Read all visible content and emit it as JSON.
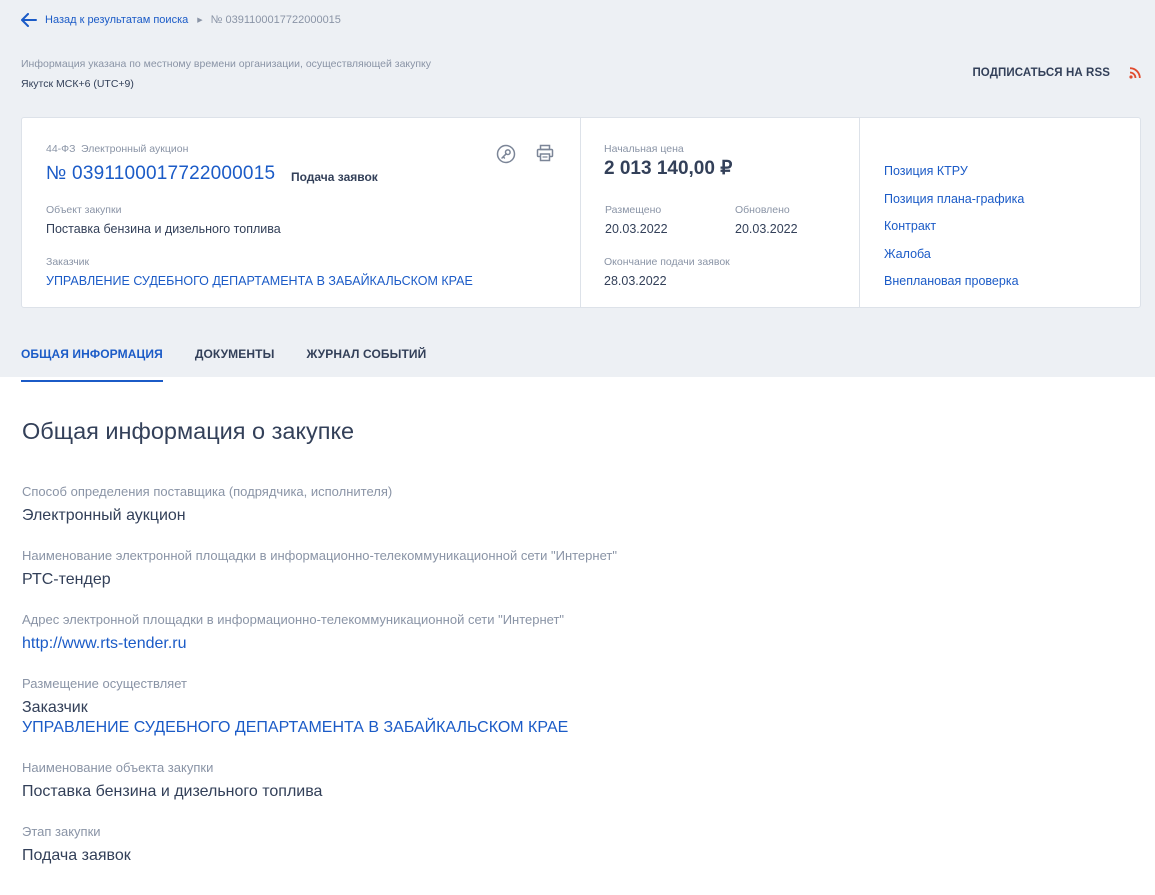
{
  "breadcrumb": {
    "back_label": "Назад к результатам поиска",
    "current": "№ 0391100017722000015"
  },
  "timezone": {
    "note": "Информация указана по местному времени организации, осуществляющей закупку",
    "value": "Якутск МСК+6 (UTC+9)"
  },
  "rss": {
    "label": "ПОДПИСАТЬСЯ НА RSS"
  },
  "card": {
    "law": "44-ФЗ",
    "procedure_type": "Электронный аукцион",
    "reg_number": "№ 0391100017722000015",
    "stage": "Подача заявок",
    "object_label": "Объект закупки",
    "object_value": "Поставка бензина и дизельного топлива",
    "customer_label": "Заказчик",
    "customer_value": "УПРАВЛЕНИЕ СУДЕБНОГО ДЕПАРТАМЕНТА В ЗАБАЙКАЛЬСКОМ КРАЕ",
    "price_label": "Начальная цена",
    "price_value": "2 013 140,00 ₽",
    "published_label": "Размещено",
    "published_value": "20.03.2022",
    "updated_label": "Обновлено",
    "updated_value": "20.03.2022",
    "deadline_label": "Окончание подачи заявок",
    "deadline_value": "28.03.2022",
    "links": [
      "Позиция КТРУ",
      "Позиция плана-графика",
      "Контракт",
      "Жалоба",
      "Внеплановая проверка"
    ]
  },
  "tabs": [
    "ОБЩАЯ ИНФОРМАЦИЯ",
    "ДОКУМЕНТЫ",
    "ЖУРНАЛ СОБЫТИЙ"
  ],
  "content": {
    "title": "Общая информация о закупке",
    "fields": [
      {
        "label": "Способ определения поставщика (подрядчика, исполнителя)",
        "value": "Электронный аукцион"
      },
      {
        "label": "Наименование электронной площадки в информационно-телекоммуникационной сети \"Интернет\"",
        "value": "РТС-тендер"
      },
      {
        "label": "Адрес электронной площадки в информационно-телекоммуникационной сети \"Интернет\"",
        "value": "http://www.rts-tender.ru"
      },
      {
        "label": "Размещение осуществляет",
        "value": "Заказчик",
        "value2": "УПРАВЛЕНИЕ СУДЕБНОГО ДЕПАРТАМЕНТА В ЗАБАЙКАЛЬСКОМ КРАЕ"
      },
      {
        "label": "Наименование объекта закупки",
        "value": "Поставка бензина и дизельного топлива"
      },
      {
        "label": "Этап закупки",
        "value": "Подача заявок"
      }
    ]
  },
  "icons": {
    "back": "arrow-left-icon",
    "separator": "triangle-right-icon",
    "rss": "rss-icon",
    "key": "key-icon",
    "print": "printer-icon"
  },
  "colors": {
    "link": "#1b5bc7",
    "rss": "#e04b2e",
    "background": "#edf0f4"
  }
}
